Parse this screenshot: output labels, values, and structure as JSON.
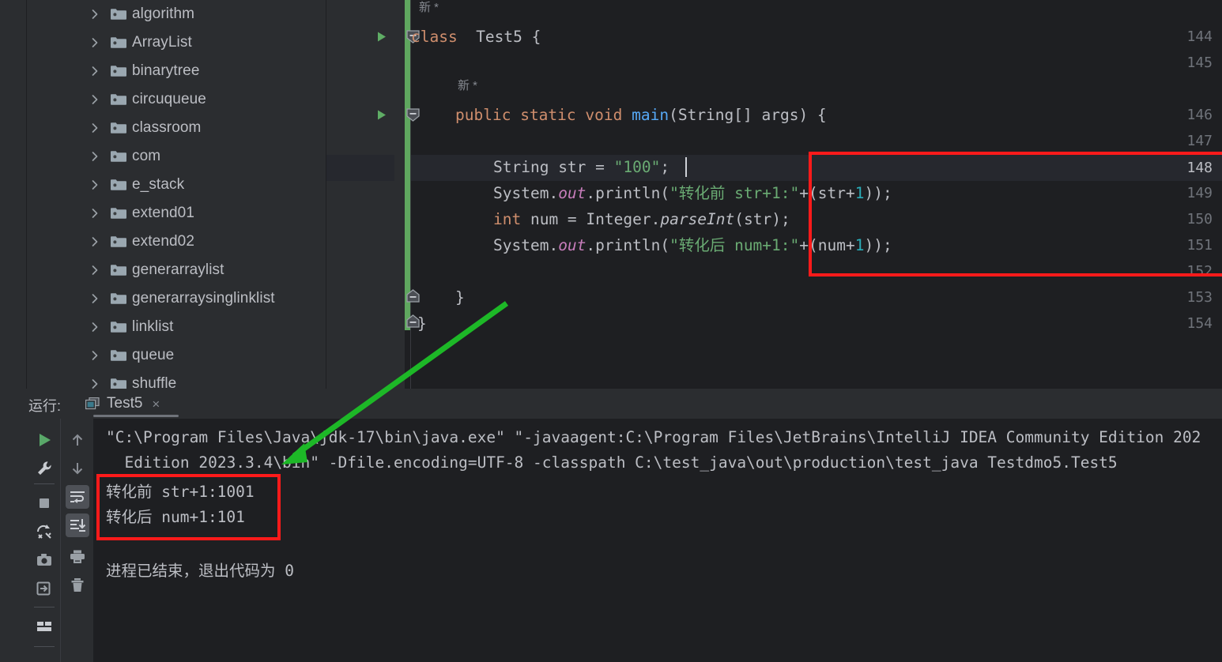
{
  "project_tree": {
    "items": [
      {
        "label": "algorithm",
        "icon": "folder-icon",
        "chevron": "chevron-right-icon"
      },
      {
        "label": "ArrayList",
        "icon": "folder-icon",
        "chevron": "chevron-right-icon"
      },
      {
        "label": "binarytree",
        "icon": "folder-icon",
        "chevron": "chevron-right-icon"
      },
      {
        "label": "circuqueue",
        "icon": "folder-icon",
        "chevron": "chevron-right-icon"
      },
      {
        "label": "classroom",
        "icon": "folder-icon",
        "chevron": "chevron-right-icon"
      },
      {
        "label": "com",
        "icon": "folder-icon",
        "chevron": "chevron-right-icon"
      },
      {
        "label": "e_stack",
        "icon": "folder-icon",
        "chevron": "chevron-right-icon"
      },
      {
        "label": "extend01",
        "icon": "folder-icon",
        "chevron": "chevron-right-icon"
      },
      {
        "label": "extend02",
        "icon": "folder-icon",
        "chevron": "chevron-right-icon"
      },
      {
        "label": "generarraylist",
        "icon": "folder-icon",
        "chevron": "chevron-right-icon"
      },
      {
        "label": "generarraysinglinklist",
        "icon": "folder-icon",
        "chevron": "chevron-right-icon"
      },
      {
        "label": "linklist",
        "icon": "folder-icon",
        "chevron": "chevron-right-icon"
      },
      {
        "label": "queue",
        "icon": "folder-icon",
        "chevron": "chevron-right-icon"
      },
      {
        "label": "shuffle",
        "icon": "folder-icon",
        "chevron": "chevron-right-icon"
      }
    ]
  },
  "editor": {
    "line_numbers": [
      "144",
      "145",
      "146",
      "147",
      "148",
      "149",
      "150",
      "151",
      "152",
      "153",
      "154"
    ],
    "current_line": "148",
    "inlay_hints": [
      "新 *",
      "新 *"
    ],
    "code_lines": {
      "l144_kw": "class",
      "l144_cls": "Test5",
      "l144_brace": "{",
      "l146_public": "public",
      "l146_static": "static",
      "l146_void": "void",
      "l146_main": "main",
      "l146_sig": "(String[] args) {",
      "l148_type": "String",
      "l148_rest": " str = ",
      "l148_str": "\"100\"",
      "l148_semi": ";",
      "l149_a": "System.",
      "l149_out": "out",
      "l149_b": ".println(",
      "l149_str": "\"转化前 str+1:\"",
      "l149_c": "+(str+",
      "l149_num": "1",
      "l149_d": "));",
      "l150_kw": "int",
      "l150_a": " num = Integer.",
      "l150_mth": "parseInt",
      "l150_b": "(str);",
      "l151_a": "System.",
      "l151_out": "out",
      "l151_b": ".println(",
      "l151_str": "\"转化后 num+1:\"",
      "l151_c": "+(num+",
      "l151_num": "1",
      "l151_d": "));",
      "l153_brace": "}",
      "l154_brace": "}"
    }
  },
  "run_panel": {
    "title": "运行:",
    "tab_label": "Test5",
    "tab_close": "×",
    "tab_icon": "run-configuration-icon",
    "toolbar_main": [
      {
        "name": "rerun-button",
        "icon": "play-icon"
      },
      {
        "name": "edit-config-button",
        "icon": "wrench-icon"
      },
      {
        "name": "stop-button",
        "icon": "stop-square-icon"
      },
      {
        "name": "rerun-failed-button",
        "icon": "rerun-failed-icon"
      },
      {
        "name": "screenshot-button",
        "icon": "camera-icon"
      },
      {
        "name": "export-button",
        "icon": "export-icon"
      },
      {
        "name": "layout-button",
        "icon": "layout-icon"
      }
    ],
    "toolbar_secondary": [
      {
        "name": "up-button",
        "icon": "arrow-up-icon",
        "active": false
      },
      {
        "name": "down-button",
        "icon": "arrow-down-icon",
        "active": false
      },
      {
        "name": "soft-wrap-button",
        "icon": "soft-wrap-icon",
        "active": true
      },
      {
        "name": "scroll-to-end-button",
        "icon": "scroll-end-icon",
        "active": true
      },
      {
        "name": "print-button",
        "icon": "printer-icon",
        "active": false
      },
      {
        "name": "clear-all-button",
        "icon": "trash-icon",
        "active": false
      }
    ],
    "console_lines": [
      "\"C:\\Program Files\\Java\\jdk-17\\bin\\java.exe\" \"-javaagent:C:\\Program Files\\JetBrains\\IntelliJ IDEA Community Edition 202",
      "  Edition 2023.3.4\\bin\" -Dfile.encoding=UTF-8 -classpath C:\\test_java\\out\\production\\test_java Testdmo5.Test5",
      "转化前 str+1:1001",
      "转化后 num+1:101",
      "进程已结束，退出代码为 0"
    ]
  },
  "annotations": {
    "red_box_editor_label": "highlight-code-block",
    "red_box_console_label": "highlight-output-block",
    "arrow_label": "annotation-arrow",
    "red_color": "#ff1a1a",
    "arrow_color": "#1db827"
  }
}
